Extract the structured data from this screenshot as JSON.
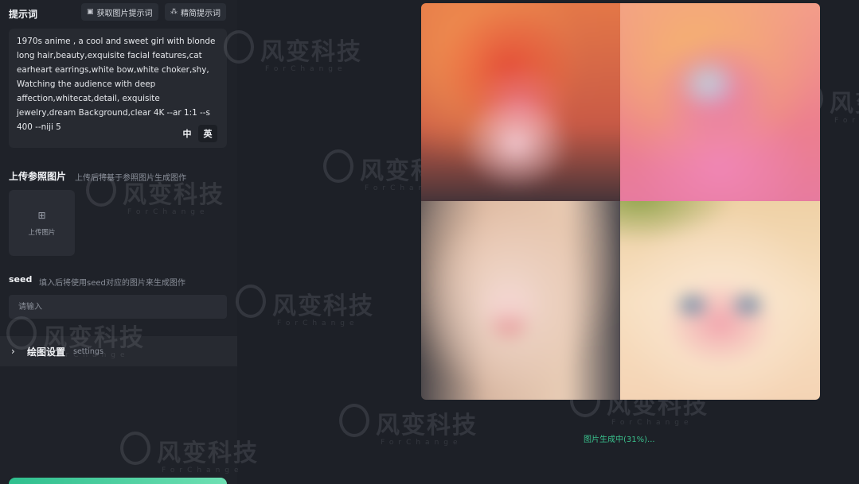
{
  "prompt_section": {
    "title": "提示词",
    "get_prompt_btn": "获取图片提示词",
    "refine_prompt_btn": "精简提示词",
    "prompt_text": "1970s anime , a cool and sweet girl with blonde long hair,beauty,exquisite facial features,cat earheart earrings,white bow,white choker,shy, Watching the audience with deep affection,whitecat,detail, exquisite jewelry,dream Background,clear 4K --ar 1:1 --s 400 --niji 5",
    "lang_zh": "中",
    "lang_en": "英"
  },
  "reference_section": {
    "title": "上传参照图片",
    "hint": "上传后将基于参照图片生成图作",
    "upload_label": "上传图片"
  },
  "seed_section": {
    "title": "seed",
    "hint": "填入后将使用seed对应的图片来生成图作",
    "placeholder": "请输入"
  },
  "settings_section": {
    "title": "绘图设置",
    "subtitle": "settings"
  },
  "status": {
    "text": "图片生成中(31%)...",
    "progress": 31,
    "color": "#39c08c"
  },
  "watermark": {
    "text": "风变科技",
    "sub": "ForChange"
  },
  "colors": {
    "accent": "#39c08c",
    "panel": "#1f2229",
    "field": "#2a2d35"
  }
}
